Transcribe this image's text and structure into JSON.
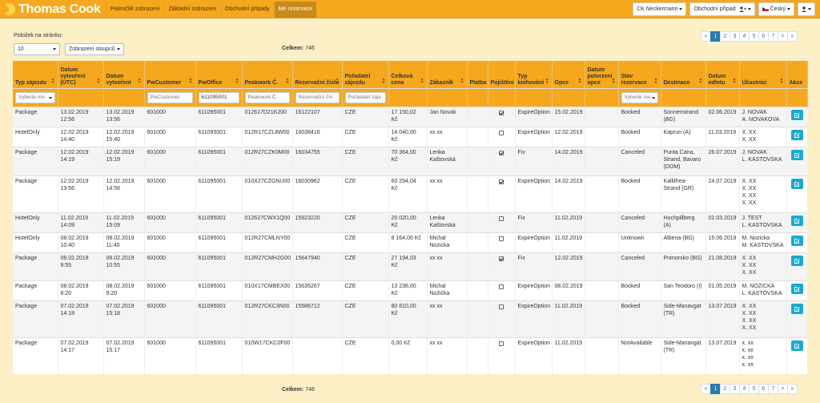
{
  "brand": {
    "name": "Thomas Cook"
  },
  "nav": {
    "links": [
      {
        "label": "Pokročilé zobrazení",
        "active": false
      },
      {
        "label": "Základní zobrazení",
        "active": false
      },
      {
        "label": "Obchodní případy",
        "active": false
      },
      {
        "label": "Mé rezervace",
        "active": true
      }
    ],
    "company": "CK Neckermann",
    "cases": "Obchodní případ",
    "language": "Český"
  },
  "controls": {
    "per_page_label": "Položek na stránku:",
    "per_page_value": "10",
    "columns_button": "Zobrazení sloupců",
    "total_label": "Celkem:",
    "total_value": "746"
  },
  "pagination": [
    "«",
    "1",
    "2",
    "3",
    "4",
    "5",
    "6",
    "7",
    ">",
    "»"
  ],
  "table": {
    "columns": [
      "Typ zájezdu",
      "Datum vytvoření (UTC)",
      "Datum vytvoření",
      "PwCustomer",
      "PwOffice",
      "Peakwork Č.",
      "Rezervační číslo",
      "Pořadatel zájezdu",
      "Celková cena",
      "Zákazník",
      "Platba",
      "Pojištění",
      "Typ knihování",
      "Opce",
      "Datum potvrzení opce",
      "Stav rezervace",
      "Destinace",
      "Datum odletu",
      "Účastníci",
      "Akce"
    ],
    "filters": {
      "typ": "Vyberte mo",
      "pwcustomer": "PwCustomer",
      "pwoffice": "611095001",
      "peakwork": "Peakwork Č.",
      "rezervace": "Rezervační čís",
      "poradatel": "Pořadatel záje",
      "stav": "Vyberte mo"
    },
    "rows": [
      {
        "typ": "Package",
        "dutc": "13.02.2019 12:56",
        "d": "13.02.2019 13:56",
        "cust": "601000",
        "office": "611095001",
        "pw": "012617D21K200",
        "rez": "16122107",
        "por": "CZE",
        "cena": "17 150,02 Kč",
        "zak": "Jan Novak",
        "plat": "",
        "poj": true,
        "typk": "ExpireOption",
        "opce": "15.02.2019",
        "dpo": "",
        "stav": "Booked",
        "dest": "Sonnenstrand (BG)",
        "odlet": "02.06.2019",
        "ucast": "J. NOVAK\nA. NOVAKOVA"
      },
      {
        "typ": "HotelOnly",
        "dutc": "12.02.2019 14:40",
        "d": "12.02.2019 15:40",
        "cust": "601000",
        "office": "611095001",
        "pw": "012R17CZL8W00",
        "rez": "16038416",
        "por": "CZE",
        "cena": "14 040,00 Kč",
        "zak": "xx xx",
        "plat": "",
        "poj": false,
        "typk": "ExpireOption",
        "opce": "12.02.2019",
        "dpo": "",
        "stav": "Booked",
        "dest": "Kaprun (A)",
        "odlet": "11.03.2019",
        "ucast": "X. XX\nX. XX"
      },
      {
        "typ": "Package",
        "dutc": "12.02.2019 14:19",
        "d": "12.02.2019 15:19",
        "cust": "601000",
        "office": "611095001",
        "pw": "012R27CZK0M00",
        "rez": "16034755",
        "por": "CZE",
        "cena": "70 364,00 Kč",
        "zak": "Lenka Kaštovská",
        "plat": "",
        "poj": true,
        "typk": "Fix",
        "opce": "14.02.2019",
        "dpo": "",
        "stav": "Canceled",
        "dest": "Punta Cana, Strand, Bavaro (DOM)",
        "odlet": "26.07.2019",
        "ucast": "J. NOVAK\nL. KASTOVSKA"
      },
      {
        "typ": "Package",
        "dutc": "12.02.2019 13:56",
        "d": "12.02.2019 14:56",
        "cust": "601000",
        "office": "611095001",
        "pw": "010X27CZGNU00",
        "rez": "16030962",
        "por": "CZE",
        "cena": "60 294,04 Kč",
        "zak": "xx xx",
        "plat": "",
        "poj": true,
        "typk": "ExpireOption",
        "opce": "14.02.2019",
        "dpo": "",
        "stav": "Booked",
        "dest": "Kallithea-Strand (GR)",
        "odlet": "24.07.2019",
        "ucast": "X. XX\nX. XX\nX. XX\nX. XX"
      },
      {
        "typ": "HotelOnly",
        "dutc": "11.02.2019 14:09",
        "d": "11.02.2019 15:09",
        "cust": "601000",
        "office": "611095001",
        "pw": "012627CWX1Q00",
        "rez": "15923220",
        "por": "CZE",
        "cena": "20 020,00 Kč",
        "zak": "Lenka Kaštovská",
        "plat": "",
        "poj": false,
        "typk": "Fix",
        "opce": "11.02.2019",
        "dpo": "",
        "stav": "Canceled",
        "dest": "Hochpillberg (A)",
        "odlet": "02.03.2019",
        "ucast": "J. TEST\nL. KASTOVSKA"
      },
      {
        "typ": "HotelOnly",
        "dutc": "08.02.2019 10:40",
        "d": "08.02.2019 11:40",
        "cust": "601000",
        "office": "611095001",
        "pw": "012R27CMLNY00",
        "rez": "",
        "por": "CZE",
        "cena": "8 164,00 Kč",
        "zak": "Michal Nozicka",
        "plat": "",
        "poj": false,
        "typk": "ExpireOption",
        "opce": "11.02.2019",
        "dpo": "",
        "stav": "Unknown",
        "dest": "Albena (BG)",
        "odlet": "15.06.2019",
        "ucast": "M. Nozicka\nM. KASTOVSKA"
      },
      {
        "typ": "Package",
        "dutc": "08.02.2019 9:55",
        "d": "08.02.2019 10:55",
        "cust": "601000",
        "office": "611095001",
        "pw": "012R27CMH2G00",
        "rez": "15647940",
        "por": "CZE",
        "cena": "27 194,03 Kč",
        "zak": "xx xx",
        "plat": "",
        "poj": true,
        "typk": "Fix",
        "opce": "12.02.2019",
        "dpo": "",
        "stav": "Canceled",
        "dest": "Primorsko (BG)",
        "odlet": "21.08.2019",
        "ucast": "X. XX\nX. XX\nX. XX"
      },
      {
        "typ": "Package",
        "dutc": "08.02.2019 8:20",
        "d": "08.02.2019 9:20",
        "cust": "601000",
        "office": "611095001",
        "pw": "010X17CMBEX00",
        "rez": "15635267",
        "por": "CZE",
        "cena": "13 236,00 Kč",
        "zak": "Michal Nožička",
        "plat": "",
        "poj": false,
        "typk": "ExpireOption",
        "opce": "08.02.2019",
        "dpo": "",
        "stav": "Booked",
        "dest": "San Teodoro (I)",
        "odlet": "01.05.2019",
        "ucast": "M. NOZICKA\nL. KASTOVSKA"
      },
      {
        "typ": "Package",
        "dutc": "07.02.2019 14:18",
        "d": "07.02.2019 15:18",
        "cust": "601000",
        "office": "611095001",
        "pw": "012R27CKC3N00",
        "rez": "15586712",
        "por": "CZE",
        "cena": "80 810,00 Kč",
        "zak": "xx xx",
        "plat": "",
        "poj": false,
        "typk": "ExpireOption",
        "opce": "11.02.2019",
        "dpo": "",
        "stav": "Booked",
        "dest": "Side-Manavgat (TR)",
        "odlet": "13.07.2019",
        "ucast": "X. XX\nX. XX\nX. XX\nX. XX"
      },
      {
        "typ": "Package",
        "dutc": "07.02.2019 14:17",
        "d": "07.02.2019 15:17",
        "cust": "601000",
        "office": "611095001",
        "pw": "010W17CKC0F00",
        "rez": "",
        "por": "CZE",
        "cena": "0,00 Kč",
        "zak": "xx xx",
        "plat": "",
        "poj": false,
        "typk": "ExpireOption",
        "opce": "11.02.2019",
        "dpo": "",
        "stav": "NotAvailable",
        "dest": "Side-Manavgat (TR)",
        "odlet": "13.07.2019",
        "ucast": "x. xx\nx. xx\nx. xx\nx. xx"
      }
    ]
  },
  "colors": {
    "accent": "#f5a81d",
    "page_bg": "#fdefc6",
    "link": "#2a7ab0",
    "edit_button": "#1ba9cf"
  },
  "icons": {
    "brand": "thomas-cook-logo-icon",
    "user": "user-icon",
    "edit": "pencil-square-icon",
    "sort": "sort-arrows-icon",
    "flag": "czech-flag-icon"
  }
}
